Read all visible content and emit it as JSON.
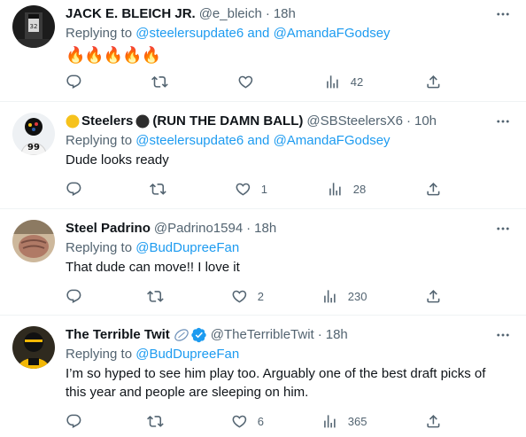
{
  "common": {
    "replying_prefix": "Replying to",
    "and_word": "and"
  },
  "tweets": [
    {
      "name": "JACK E. BLEICH JR.",
      "handle": "@e_bleich",
      "time": "18h",
      "reply_to": [
        "@steelersupdate6",
        "@AmandaFGodsey"
      ],
      "text": "🔥🔥🔥🔥🔥",
      "replies": "",
      "retweets": "",
      "likes": "",
      "views": "42"
    },
    {
      "name_a": "Steelers",
      "name_b": "(RUN THE DAMN BALL)",
      "handle": "@SBSteelersX6",
      "time": "10h",
      "reply_to": [
        "@steelersupdate6",
        "@AmandaFGodsey"
      ],
      "text": "Dude looks ready",
      "replies": "",
      "retweets": "",
      "likes": "1",
      "views": "28"
    },
    {
      "name": "Steel Padrino",
      "handle": "@Padrino1594",
      "time": "18h",
      "reply_to": [
        "@BudDupreeFan"
      ],
      "text": "That dude can move!! I love it",
      "replies": "",
      "retweets": "",
      "likes": "2",
      "views": "230"
    },
    {
      "name": "The Terrible Twit",
      "handle": "@TheTerribleTwit",
      "time": "18h",
      "reply_to": [
        "@BudDupreeFan"
      ],
      "text": "I’m so hyped to see him play too. Arguably one of the best draft picks of this year and people are sleeping on him.",
      "replies": "",
      "retweets": "",
      "likes": "6",
      "views": "365"
    }
  ],
  "colors": {
    "accent": "#1d9bf0",
    "muted": "#536471",
    "text": "#0f1419",
    "divider": "#eff3f4"
  }
}
